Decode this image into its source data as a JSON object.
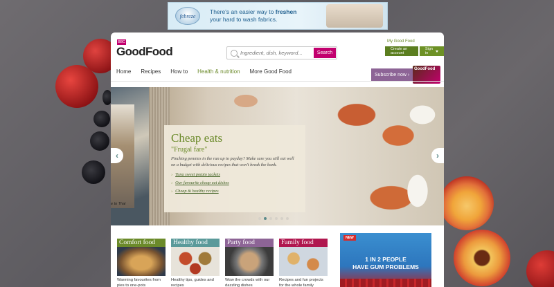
{
  "ad_top": {
    "brand": "febreze",
    "line1": "There's an easier way to",
    "bold": "freshen",
    "line2": "your hard to wash fabrics."
  },
  "header": {
    "badge": "BBC",
    "logo": "GoodFood",
    "search_placeholder": "Ingredient, dish, keyword...",
    "search_button": "Search",
    "my_good_food": "My Good Food",
    "create_account": "Create an account",
    "sign_in": "Sign in"
  },
  "nav": {
    "items": [
      "Home",
      "Recipes",
      "How to",
      "Health & nutrition",
      "More Good Food"
    ],
    "active_index": 3,
    "subscribe": "Subscribe now ›",
    "magazine_label": "GoodFood"
  },
  "hero": {
    "title": "Cheap eats",
    "subtitle": "\"Frugal fare\"",
    "description": "Pinching pennies in the run up to payday? Make sure you still eat well on a budget with delicious recipes that won't break the bank.",
    "links": [
      "Tuna sweet potato jackets",
      "Our favourite cheap eat dishes",
      "Cheap & healthy recipes"
    ],
    "left_arrow": "‹",
    "right_arrow": "›",
    "dots_count": 6,
    "active_dot": 1,
    "prev_caption": "e to Thai"
  },
  "cards": [
    {
      "title": "Comfort food",
      "text": "Warming favourites from pies to one-pots",
      "color": "#6b8a2a"
    },
    {
      "title": "Healthy food",
      "text": "Healthy tips, guides and recipes",
      "color": "#5b9a9a"
    },
    {
      "title": "Party food",
      "text": "Wow the crowds with our dazzling dishes",
      "color": "#8d6496"
    },
    {
      "title": "Family food",
      "text": "Recipes and fun projects for the whole family",
      "color": "#b0174f"
    }
  ],
  "ad_side": {
    "tag": "NEW",
    "line1": "1 IN 2 PEOPLE",
    "line2": "HAVE GUM PROBLEMS"
  },
  "colors": {
    "accent_green": "#6b8a2a",
    "brand_pink": "#c2006e",
    "subscribe_purple": "#8d6496"
  }
}
